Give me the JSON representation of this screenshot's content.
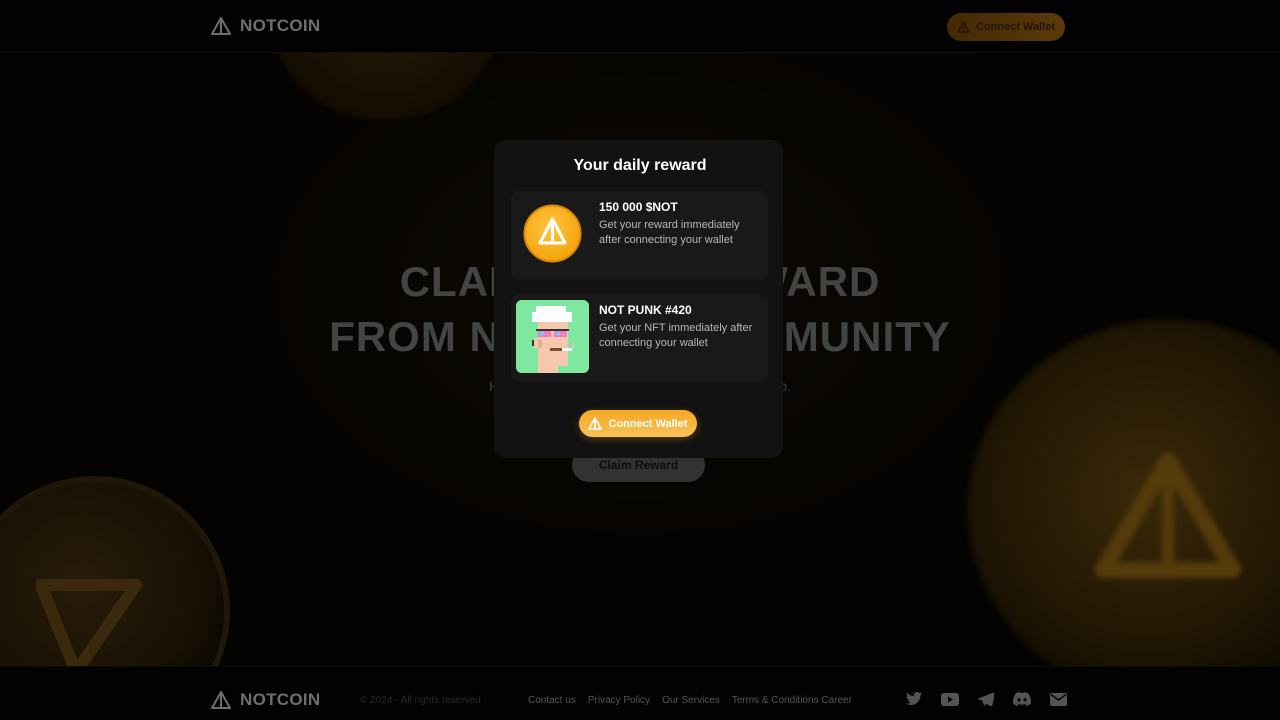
{
  "header": {
    "brand": "NOTCOIN",
    "cta_label": "Connect Wallet"
  },
  "hero": {
    "title_line1": "CLAIM YOUR REWARD",
    "title_line2": "FROM NOTCOIN COMMUNITY",
    "subtitle": "Hurry up and claim your reward from the airdrop.",
    "claim_label": "Claim Reward"
  },
  "modal": {
    "title": "Your daily reward",
    "items": [
      {
        "title": "150 000 $NOT",
        "description": "Get your reward immediately after connecting your wallet",
        "icon": "notcoin-coin-icon"
      },
      {
        "title": "NOT PUNK #420",
        "description": "Get your NFT immediately after connecting your wallet",
        "icon": "punk-nft-image"
      }
    ],
    "cta_label": "Connect Wallet"
  },
  "footer": {
    "brand": "NOTCOIN",
    "copyright": "© 2024 · All rights reserved",
    "links": [
      "Contact us",
      "Privacy Policy",
      "Our Services",
      "Terms & Conditions Career"
    ],
    "socials": [
      "twitter-icon",
      "youtube-icon",
      "telegram-icon",
      "discord-icon",
      "mail-icon"
    ]
  },
  "colors": {
    "accent": "#f6a623",
    "accent_light": "#f7c35a",
    "modal_bg": "#121212",
    "card_bg": "#191919"
  }
}
